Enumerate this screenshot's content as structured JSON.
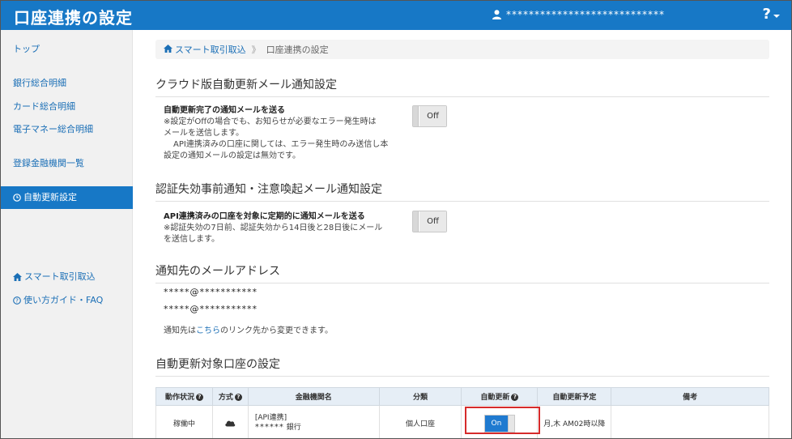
{
  "header": {
    "title": "口座連携の設定",
    "user_masked": "****************************",
    "help_label": "?"
  },
  "sidebar": {
    "items": [
      {
        "label": "トップ"
      },
      {
        "label": "銀行総合明細"
      },
      {
        "label": "カード総合明細"
      },
      {
        "label": "電子マネー総合明細"
      },
      {
        "label": "登録金融機関一覧"
      },
      {
        "label": "自動更新設定",
        "active": true
      },
      {
        "label": "スマート取引取込"
      },
      {
        "label": "使い方ガイド・FAQ"
      }
    ]
  },
  "breadcrumb": {
    "home_label": "スマート取引取込",
    "separator": "》",
    "current": "口座連携の設定"
  },
  "sections": {
    "cloud_mail": {
      "title": "クラウド版自動更新メール通知設定",
      "option_title": "自動更新完了の通知メールを送る",
      "lines": [
        "※設定がOffの場合でも、お知らせが必要なエラー発生時は",
        "メールを送信します。",
        "API連携済みの口座に関しては、エラー発生時のみ送信し本",
        "設定の通知メールの設定は無効です。"
      ],
      "toggle_label": "Off"
    },
    "auth_mail": {
      "title": "認証失効事前通知・注意喚起メール通知設定",
      "option_title": "API連携済みの口座を対象に定期的に通知メールを送る",
      "lines": [
        "※認証失効の7日前、認証失効から14日後と28日後にメール",
        "を送信します。"
      ],
      "toggle_label": "Off"
    },
    "email": {
      "title": "通知先のメールアドレス",
      "addresses": [
        "*****@***********",
        "*****@***********"
      ],
      "note_prefix": "通知先は",
      "note_link": "こちら",
      "note_suffix": "のリンク先から変更できます。"
    },
    "accounts": {
      "title": "自動更新対象口座の設定"
    }
  },
  "table": {
    "headers": {
      "status": "動作状況",
      "method": "方式",
      "institution": "金融機関名",
      "category": "分類",
      "auto_update": "自動更新",
      "schedule": "自動更新予定",
      "remarks": "備考"
    },
    "rows": [
      {
        "status": "稼働中",
        "institution_tag": "[API連携]",
        "institution_name": "******",
        "institution_suffix": "銀行",
        "category": "個人口座",
        "auto_update": "On",
        "schedule": "月,木 AM02時以降",
        "remarks": ""
      }
    ]
  },
  "colors": {
    "primary": "#1778c6",
    "link": "#1b6fb6",
    "highlight": "#d62b2b",
    "toggle_on": "#1f7ad0"
  }
}
